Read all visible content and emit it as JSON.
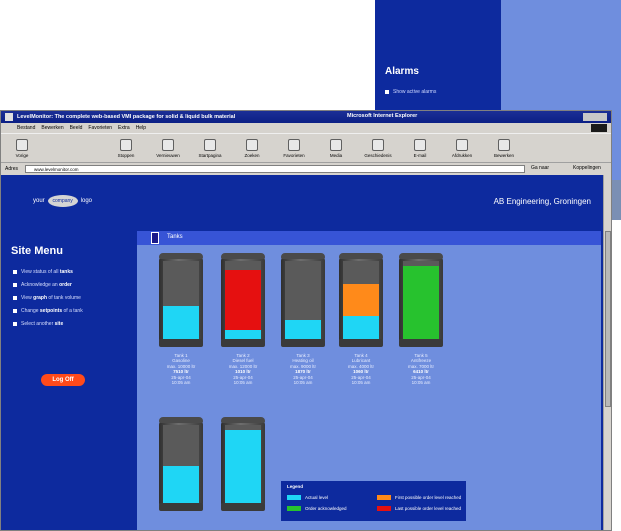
{
  "background_window": {
    "title": "Alarms",
    "item": "Show active alarms"
  },
  "browser": {
    "title": "LevelMonitor: The complete web-based VMI package for solid & liquid bulk material",
    "title_suffix": "Microsoft Internet Explorer",
    "menu": [
      "Bestand",
      "Bewerken",
      "Beeld",
      "Favorieten",
      "Extra",
      "Help"
    ],
    "toolbar": [
      "Vorige",
      "Stoppen",
      "Vernieuwen",
      "Startpagina",
      "Zoeken",
      "Favorieten",
      "Media",
      "Geschiedenis",
      "E-mail",
      "Afdrukken",
      "Bewerken"
    ],
    "address_label": "Adres",
    "address_value": "www.levelmonitor.com",
    "go_label": "Ga naar",
    "links_label": "Koppelingen"
  },
  "site": {
    "logo_text": "your",
    "logo_oval": "company",
    "logo_suffix": "logo",
    "company": "AB Engineering, Groningen"
  },
  "menu": {
    "title": "Site Menu",
    "items": [
      {
        "pre": "View status of all ",
        "bold": "tanks",
        "post": ""
      },
      {
        "pre": "Acknowledge an ",
        "bold": "order",
        "post": ""
      },
      {
        "pre": "View ",
        "bold": "graph",
        "post": " of tank volume"
      },
      {
        "pre": "Change ",
        "bold": "setpoints",
        "post": " of a tank"
      },
      {
        "pre": "Select another ",
        "bold": "site",
        "post": ""
      }
    ],
    "logoff": "Log Off"
  },
  "content": {
    "title": "Tanks"
  },
  "tanks": [
    {
      "name": "Tank 1",
      "product": "Gasoline",
      "max": "max. 10000 ltr",
      "level": "7510 ltr",
      "date": "25-apr-04",
      "time": "10:05 am",
      "fill": 0.42,
      "color": "#1fd6f5",
      "top": ""
    },
    {
      "name": "Tank 2",
      "product": "Diesel fuel",
      "max": "max. 12000 ltr",
      "level": "1010 ltr",
      "date": "25-apr-04",
      "time": "10:05 am",
      "fill": 0.12,
      "color": "#1fd6f5",
      "top": "#e51010"
    },
    {
      "name": "Tank 3",
      "product": "Heating oil",
      "max": "max. 9000 ltr",
      "level": "1870 ltr",
      "date": "25-apr-04",
      "time": "10:05 am",
      "fill": 0.24,
      "color": "#1fd6f5",
      "top": ""
    },
    {
      "name": "Tank 4",
      "product": "Lubricant",
      "max": "max. 4000 ltr",
      "level": "1060 ltr",
      "date": "25-apr-04",
      "time": "10:05 am",
      "fill": 0.3,
      "color": "#1fd6f5",
      "top": "#ff8a1a"
    },
    {
      "name": "Tank 5",
      "product": "Antifreeze",
      "max": "max. 7000 ltr",
      "level": "6410 ltr",
      "date": "25-apr-04",
      "time": "10:05 am",
      "fill": 0.94,
      "color": "#27c22e",
      "top": ""
    },
    {
      "name": "",
      "product": "",
      "max": "",
      "level": "",
      "date": "",
      "time": "",
      "fill": 0.48,
      "color": "#1fd6f5",
      "top": ""
    },
    {
      "name": "",
      "product": "",
      "max": "",
      "level": "",
      "date": "",
      "time": "",
      "fill": 0.94,
      "color": "#1fd6f5",
      "top": ""
    }
  ],
  "legend": {
    "title": "Legend",
    "items": [
      {
        "label": "Actual level",
        "color": "#1fd6f5"
      },
      {
        "label": "First possible order level reached",
        "color": "#ff8a1a"
      },
      {
        "label": "Order acknowledged",
        "color": "#27c22e"
      },
      {
        "label": "Last possible order level reached",
        "color": "#e51010"
      }
    ]
  }
}
